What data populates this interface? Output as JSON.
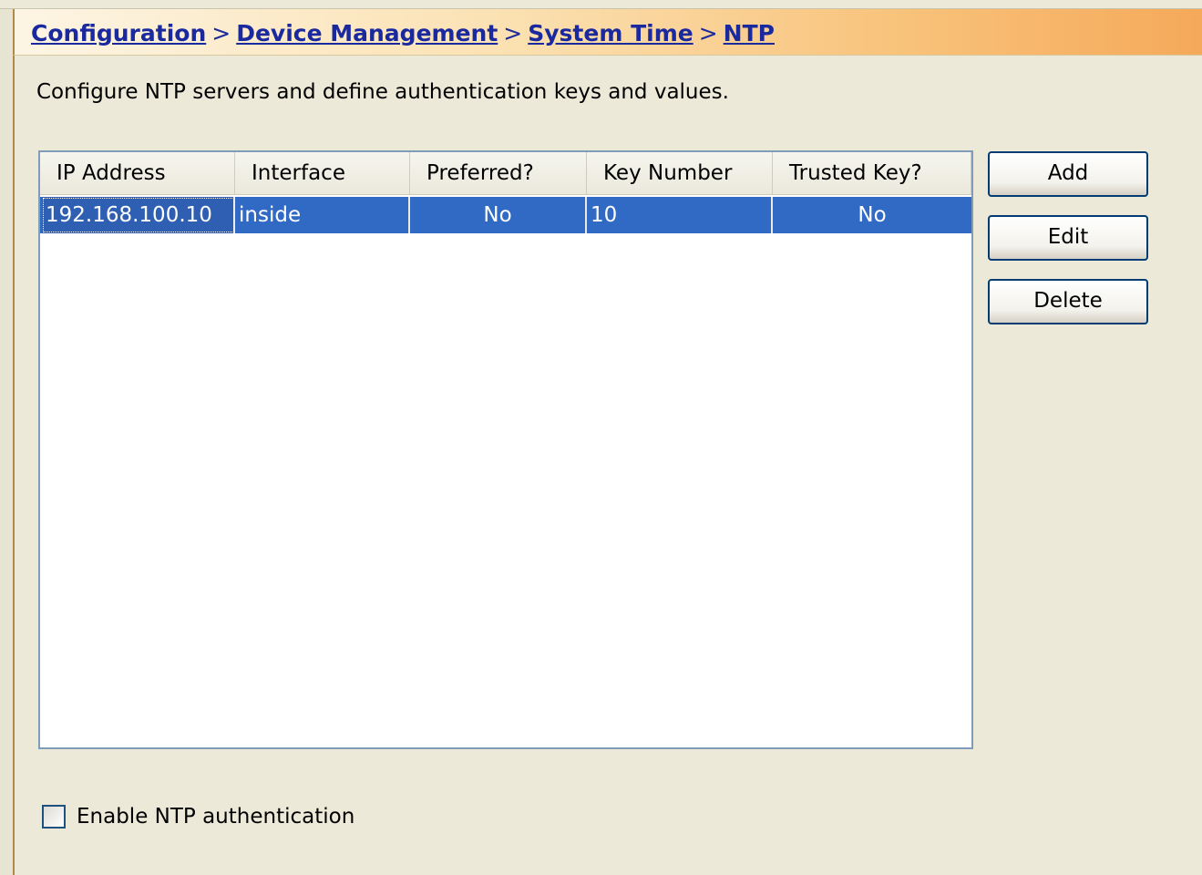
{
  "breadcrumb": {
    "items": [
      "Configuration",
      "Device Management",
      "System Time",
      "NTP"
    ],
    "separator": ">"
  },
  "description": "Configure NTP servers and define authentication keys and values.",
  "table": {
    "columns": [
      "IP Address",
      "Interface",
      "Preferred?",
      "Key Number",
      "Trusted Key?"
    ],
    "rows": [
      {
        "ip": "192.168.100.10",
        "interface": "inside",
        "preferred": "No",
        "key": "10",
        "trusted": "No"
      }
    ]
  },
  "buttons": {
    "add": "Add",
    "edit": "Edit",
    "delete": "Delete"
  },
  "auth": {
    "label": "Enable NTP authentication",
    "checked": false
  },
  "colors": {
    "selection": "#316ac5",
    "link": "#1a2a9e",
    "header_accent": "#f5a95a"
  }
}
